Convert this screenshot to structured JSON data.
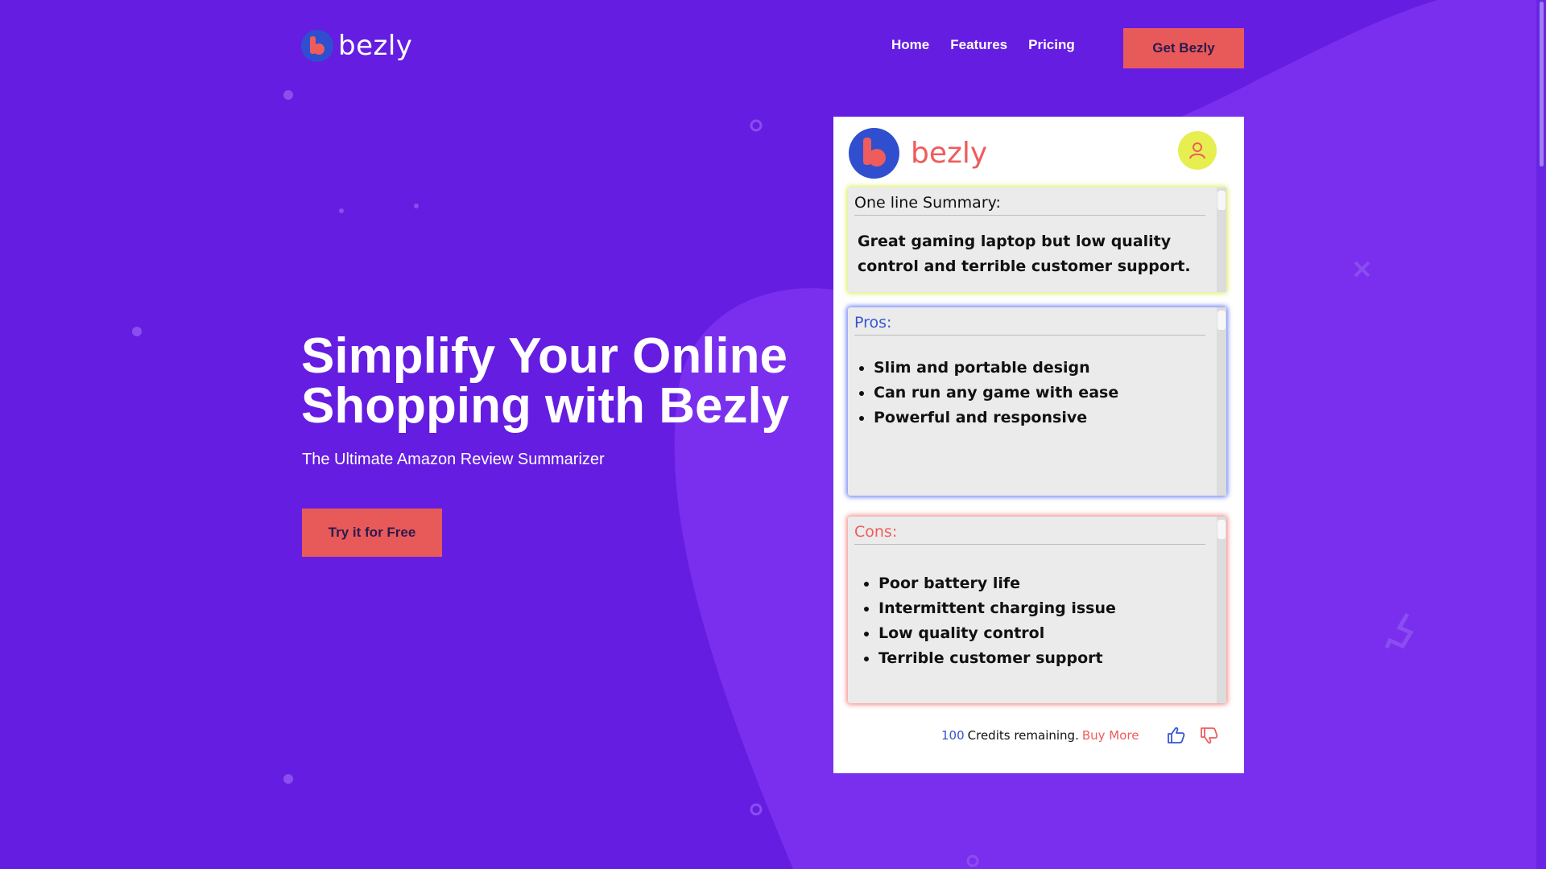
{
  "colors": {
    "background": "#651de1",
    "accent": "#e85a5a",
    "panel_blue": "#3555d6",
    "panel_red": "#ef5c5c",
    "avatar_yellow": "#e6ef4f"
  },
  "header": {
    "logo_text": "bezly",
    "nav": [
      "Home",
      "Features",
      "Pricing"
    ],
    "cta": "Get Bezly"
  },
  "hero": {
    "title_line1": "Simplify Your Online",
    "title_line2": "Shopping with Bezly",
    "subtitle": "The Ultimate Amazon Review Summarizer",
    "cta": "Try it for Free"
  },
  "extension": {
    "logo_text": "bezly",
    "avatar_icon": "user-icon",
    "summary": {
      "heading": "One line Summary:",
      "text": "Great gaming laptop but low quality control and terrible customer support."
    },
    "pros": {
      "heading": "Pros:",
      "items": [
        "Slim and portable design",
        "Can run any game with ease",
        "Powerful and responsive"
      ]
    },
    "cons": {
      "heading": "Cons:",
      "items": [
        "Poor battery life",
        "Intermittent charging issue",
        "Low quality control",
        "Terrible customer support"
      ]
    },
    "credits_count": "100",
    "credits_text": "Credits remaining.",
    "buy_more": "Buy More",
    "icons": [
      "thumbs-up-icon",
      "thumbs-down-icon"
    ]
  }
}
